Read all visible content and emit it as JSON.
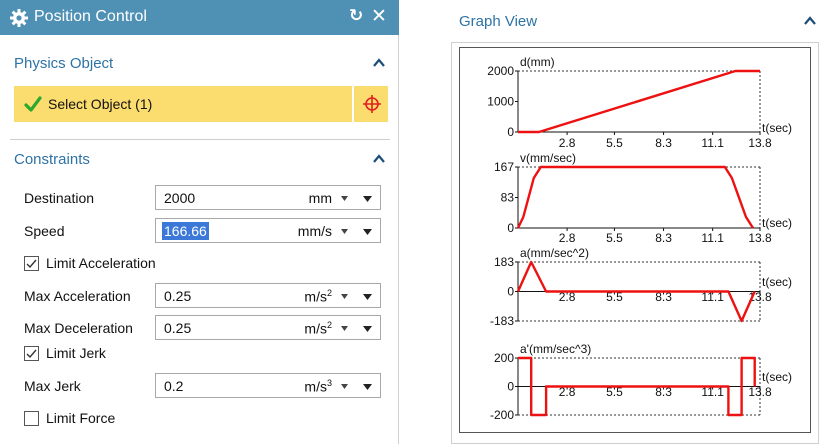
{
  "dialog": {
    "title": "Position Control",
    "physics_section": "Physics Object",
    "select_object": "Select Object (1)",
    "constraints_section": "Constraints",
    "destination": {
      "label": "Destination",
      "value": "2000",
      "unit": "mm"
    },
    "speed": {
      "label": "Speed",
      "value": "166.66",
      "unit": "mm/s"
    },
    "limit_acceleration": {
      "label": "Limit Acceleration",
      "checked": true
    },
    "max_acceleration": {
      "label": "Max Acceleration",
      "value": "0.25",
      "unit": "m/s",
      "unit_exp": "2"
    },
    "max_deceleration": {
      "label": "Max Deceleration",
      "value": "0.25",
      "unit": "m/s",
      "unit_exp": "2"
    },
    "limit_jerk": {
      "label": "Limit Jerk",
      "checked": true
    },
    "max_jerk": {
      "label": "Max Jerk",
      "value": "0.2",
      "unit": "m/s",
      "unit_exp": "3"
    },
    "limit_force": {
      "label": "Limit Force",
      "checked": false
    }
  },
  "graph_view": {
    "title": "Graph View"
  },
  "colors": {
    "accent": "#4f90b5",
    "section_text": "#2e73a6",
    "highlight": "#fbdc6e",
    "curve": "#ee1111",
    "check": "#2ca82c"
  },
  "chart_data": [
    {
      "type": "line",
      "ylabel": "d(mm)",
      "xlabel": "t(sec)",
      "xticks": [
        "2.8",
        "5.5",
        "8.3",
        "11.1",
        "13.8"
      ],
      "yticks": [
        "2000",
        "1000",
        "0"
      ],
      "ylim": [
        0,
        2000
      ],
      "xlim": [
        0,
        13.8
      ],
      "series": [
        {
          "points": [
            [
              0,
              0
            ],
            [
              1.2,
              0
            ],
            [
              12.4,
              2000
            ],
            [
              13.8,
              2000
            ]
          ]
        }
      ]
    },
    {
      "type": "line",
      "ylabel": "v(mm/sec)",
      "xlabel": "t(sec)",
      "xticks": [
        "2.8",
        "5.5",
        "8.3",
        "11.1",
        "13.8"
      ],
      "yticks": [
        "167",
        "83",
        "0"
      ],
      "ylim": [
        0,
        167
      ],
      "xlim": [
        0,
        13.8
      ],
      "series": [
        {
          "points": [
            [
              0,
              0
            ],
            [
              0.3,
              30
            ],
            [
              0.6,
              83
            ],
            [
              0.9,
              137
            ],
            [
              1.3,
              167
            ],
            [
              11.8,
              167
            ],
            [
              12.2,
              137
            ],
            [
              12.6,
              83
            ],
            [
              13.0,
              30
            ],
            [
              13.4,
              0
            ]
          ]
        }
      ]
    },
    {
      "type": "line",
      "ylabel": "a(mm/sec^2)",
      "xlabel": "t(sec)",
      "xticks": [
        "2.8",
        "5.5",
        "8.3",
        "11.1",
        "13.8"
      ],
      "yticks": [
        "183",
        "0",
        "-183"
      ],
      "ylim": [
        -183,
        183
      ],
      "xlim": [
        0,
        13.8
      ],
      "series": [
        {
          "points": [
            [
              0,
              0
            ],
            [
              0.75,
              183
            ],
            [
              1.6,
              0
            ],
            [
              12.0,
              0
            ],
            [
              12.75,
              -183
            ],
            [
              13.5,
              0
            ]
          ]
        }
      ]
    },
    {
      "type": "line",
      "ylabel": "a'(mm/sec^3)",
      "xlabel": "t(sec)",
      "xticks": [
        "2.8",
        "5.5",
        "8.3",
        "11.1",
        "13.8"
      ],
      "yticks": [
        "200",
        "0",
        "-200"
      ],
      "ylim": [
        -200,
        200
      ],
      "xlim": [
        0,
        13.8
      ],
      "series": [
        {
          "points": [
            [
              0,
              200
            ],
            [
              0.75,
              200
            ],
            [
              0.75,
              -200
            ],
            [
              1.6,
              -200
            ],
            [
              1.6,
              0
            ],
            [
              12.0,
              0
            ],
            [
              12.0,
              -200
            ],
            [
              12.75,
              -200
            ],
            [
              12.75,
              200
            ],
            [
              13.5,
              200
            ],
            [
              13.5,
              0
            ]
          ]
        }
      ]
    }
  ]
}
